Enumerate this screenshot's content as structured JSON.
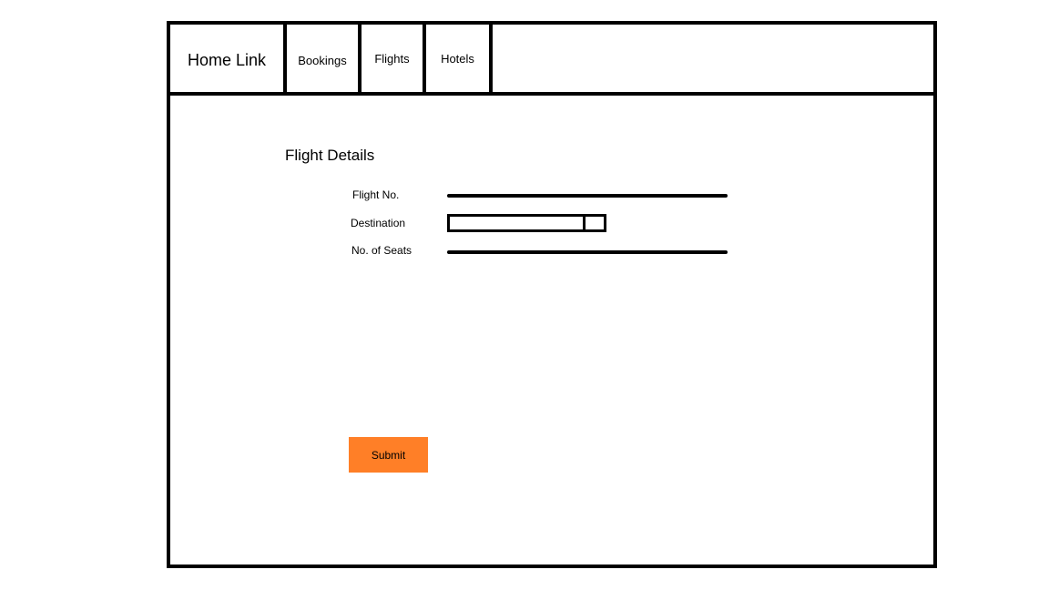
{
  "nav": {
    "home": "Home Link",
    "bookings": "Bookings",
    "flights": "Flights",
    "hotels": "Hotels"
  },
  "form": {
    "title": "Flight Details",
    "fields": {
      "flight_no": {
        "label": "Flight No.",
        "value": ""
      },
      "destination": {
        "label": "Destination",
        "value": ""
      },
      "seats": {
        "label": "No. of Seats",
        "value": ""
      }
    },
    "submit_label": "Submit"
  },
  "colors": {
    "submit_bg": "#ff7f27",
    "border": "#000000",
    "background": "#ffffff"
  }
}
